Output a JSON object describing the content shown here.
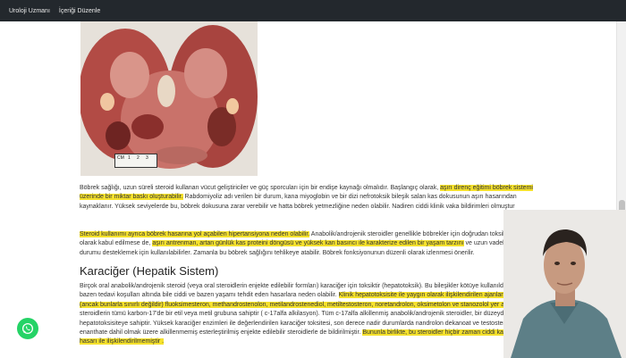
{
  "topbar": {
    "items": [
      "Uroloji Uzmanı",
      "İçeriği Düzenle"
    ]
  },
  "figure": {
    "ruler_label": "CM 1 2 3",
    "ruler_ticks": [
      "CM",
      "1",
      "2",
      "3"
    ]
  },
  "p1": {
    "s1": "Böbrek sağlığı, uzun süreli steroid kullanan vücut geliştiriciler ve güç sporcuları için bir endişe kaynağı olmalıdır. Başlangıç olarak, ",
    "s2": "aşırı direnç eğitimi böbrek sistemi üzerinde bir miktar baskı oluşturabilir.",
    "s3": " Rabdomiyoliz adı verilen bir durum, kana miyoglobin ve bir dizi nefrotoksik bileşik salan kas dokusunun aşırı hasarından kaynaklanır. Yüksek seviyelerde bu, böbrek dokusuna zarar verebilir ve hatta böbrek yetmezliğine neden olabilir. Nadiren ciddi klinik vaka bildirimleri olmuştur"
  },
  "p2": {
    "s1": "Steroid kullanımı ayrıca böbrek hasarına yol açabilen hipertansiyona neden olabilir.",
    "s2": " Anabolik/androjenik steroidler genellikle böbrekler için doğrudan toksik ilaçlar olarak kabul edilmese de, ",
    "s3": "aşırı antrenman, artan günlük kas proteini döngüsü ve yüksek kan basıncı ile karakterize edilen bir yaşam tarzını",
    "s4": " ve uzun vadeli metabolik durumu desteklemek için kullanılabilirler. Zamanla bu böbrek sağlığını tehlikeye atabilir. Böbrek fonksiyonunun düzenli olarak izlenmesi önerilir."
  },
  "heading": "Karaciğer (Hepatik Sistem)",
  "p3": {
    "s1": "Birçok oral anabolik/androjenik steroid (veya oral steroidlerin enjekte edilebilir formları) karaciğer için toksiktir (hepatotoksik). Bu bileşikler kötüye kullanıldıklarında ve bazen tedavi koşulları altında bile ciddi ve bazen yaşamı tehdit eden hasarlara neden olabilir. ",
    "s2": "Klinik hepatotoksisite ile yaygın olarak ilişkilendirilen ajanlar arasında (ancak bunlarla sınırlı değildir) fluoksimesteron, methandrostenolon, metilandrostenediol, metiltestosteron, noretandrolon, oksimetolon ve stanozolol yer alır.",
    "s3": " Bu steroidlerin tümü karbon-17'de bir etil veya metil grubuna sahiptir ( c-17alfa alkilasyon). Tüm c-17alfa alkillenmiş anabolik/androjenik steroidler, bir düzeyde hepatotoksisiteye sahiptir. Yüksek karaciğer enzimleri ile değerlendirilen karaciğer toksitesi, son derece nadir durumlarda nandrolon dekanoat ve testosteron enanthate dahil olmak üzere alkillenmemiş esterleştirilmiş enjekte edilebilir steroidlerle de bildirilmiştir. ",
    "s4": "Bununla birlikte, bu steroidler hiçbir zaman ciddi karaciğer hasarı ile ilişkilendirilmemiştir ."
  },
  "colors": {
    "highlight": "#f5e12c",
    "topbar": "#23282d",
    "whatsapp": "#25d366"
  },
  "icons": {
    "whatsapp": "whatsapp-icon"
  }
}
